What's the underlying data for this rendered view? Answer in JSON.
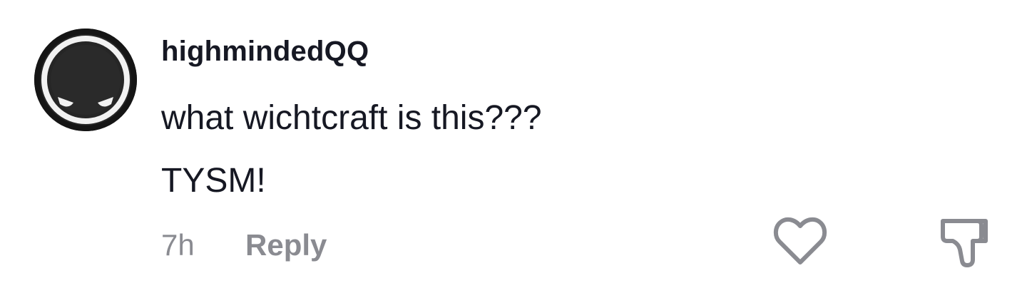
{
  "comment": {
    "username": "highmindedQQ",
    "lines": [
      "what wichtcraft is this???",
      "TYSM!"
    ],
    "timestamp": "7h",
    "reply_label": "Reply",
    "avatar_icon": "masked-face-avatar",
    "like_icon": "heart-outline-icon",
    "dislike_icon": "thumbs-down-outline-icon",
    "colors": {
      "text": "#161823",
      "secondary": "#8a8b91",
      "icon": "#8a8b91",
      "avatar_bg": "#111111"
    }
  }
}
